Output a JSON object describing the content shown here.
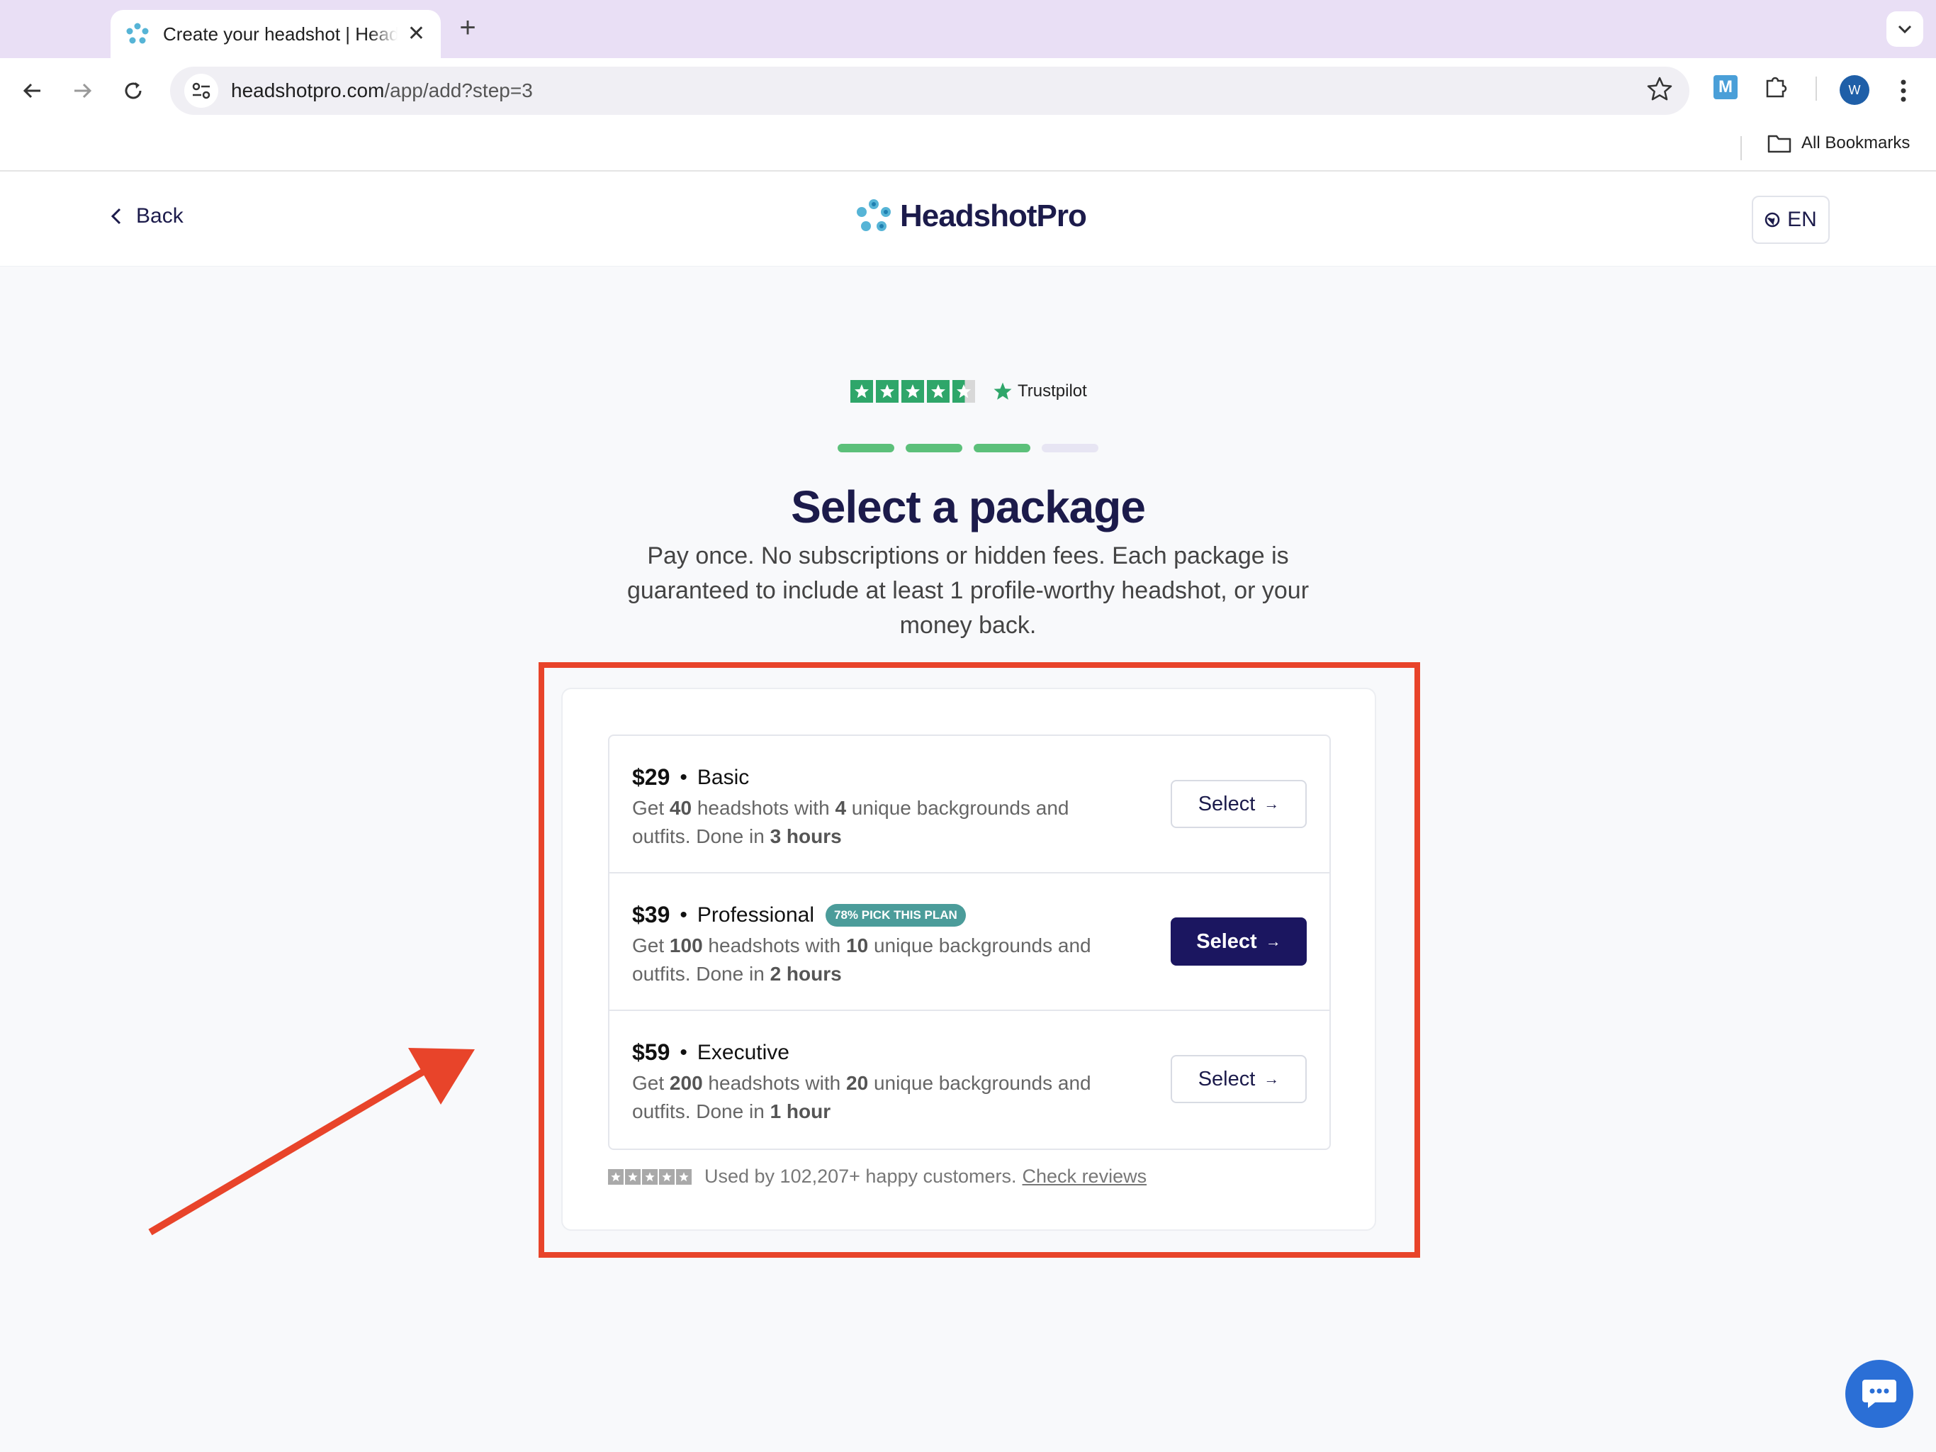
{
  "browser": {
    "tab_title": "Create your headshot | HeadshotPro",
    "new_tab_symbol": "+",
    "close_symbol": "✕",
    "url_host": "headshotpro.com",
    "url_path": "/app/add?step=3",
    "extension_letter": "M",
    "profile_initial": "W",
    "bookmarks_label": "All Bookmarks"
  },
  "header": {
    "back_label": "Back",
    "logo_text": "HeadshotPro",
    "language": "EN"
  },
  "trustpilot": {
    "brand": "Trustpilot",
    "rating": 4.5
  },
  "progress": {
    "current_step": 3,
    "total_steps": 4
  },
  "main": {
    "title": "Select a package",
    "subtitle": "Pay once. No subscriptions or hidden fees. Each package is guaranteed to include at least 1 profile-worthy headshot, or your money back."
  },
  "plans": [
    {
      "price": "$29",
      "separator": "•",
      "name": "Basic",
      "badge": "",
      "desc_get": "Get",
      "headshots": "40",
      "desc_with": "headshots with",
      "backgrounds": "4",
      "desc_rest": "unique backgrounds and outfits. Done in",
      "turnaround": "3 hours",
      "button": "Select",
      "primary": false
    },
    {
      "price": "$39",
      "separator": "•",
      "name": "Professional",
      "badge": "78% PICK THIS PLAN",
      "desc_get": "Get",
      "headshots": "100",
      "desc_with": "headshots with",
      "backgrounds": "10",
      "desc_rest": "unique backgrounds and outfits. Done in",
      "turnaround": "2 hours",
      "button": "Select",
      "primary": true
    },
    {
      "price": "$59",
      "separator": "•",
      "name": "Executive",
      "badge": "",
      "desc_get": "Get",
      "headshots": "200",
      "desc_with": "headshots with",
      "backgrounds": "20",
      "desc_rest": "unique backgrounds and outfits. Done in",
      "turnaround": "1 hour",
      "button": "Select",
      "primary": false
    }
  ],
  "social_proof": {
    "text": "Used by 102,207+ happy customers.",
    "link": "Check reviews"
  },
  "colors": {
    "highlight_box": "#e8442a",
    "annotation_arrow": "#e8442a",
    "primary_button": "#1b1660",
    "progress_done": "#5cc07a",
    "progress_todo": "#e7e5f3",
    "trustpilot_green": "#2fa66a",
    "badge": "#4b9c9a",
    "chat_button": "#2b6fd6"
  }
}
